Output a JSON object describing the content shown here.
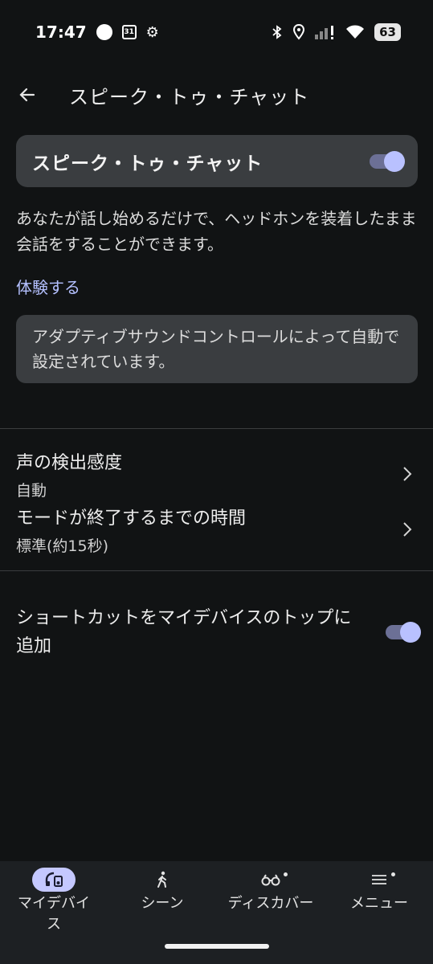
{
  "status_bar": {
    "time": "17:47",
    "calendar_day": "31",
    "battery": "63",
    "icons": [
      "circle-notification-icon",
      "calendar-icon",
      "gear-icon",
      "bluetooth-icon",
      "location-icon",
      "signal-icon",
      "wifi-icon",
      "battery-icon"
    ]
  },
  "appbar": {
    "back_icon": "arrow-left-icon",
    "title": "スピーク・トゥ・チャット"
  },
  "main_toggle": {
    "label": "スピーク・トゥ・チャット",
    "state": "on"
  },
  "description": "あなたが話し始めるだけで、ヘッドホンを装着したまま会話をすることができます。",
  "try_link": "体験する",
  "info_card": "アダプティブサウンドコントロールによって自動で設定されています。",
  "settings": [
    {
      "title": "声の検出感度",
      "value": "自動"
    },
    {
      "title": "モードが終了するまでの時間",
      "value": "標準(約15秒)"
    }
  ],
  "shortcut": {
    "label": "ショートカットをマイデバイスのトップに追加",
    "state": "on"
  },
  "bottom_nav": [
    {
      "label": "マイデバイス",
      "icon": "headphones-device-icon",
      "active": true
    },
    {
      "label": "シーン",
      "icon": "walking-person-icon",
      "active": false
    },
    {
      "label": "ディスカバー",
      "icon": "binoculars-icon",
      "active": false
    },
    {
      "label": "メニュー",
      "icon": "menu-lines-icon",
      "active": false
    }
  ],
  "colors": {
    "background": "#111314",
    "card": "#3a3d40",
    "accent": "#b9c1ff",
    "link": "#b4c0ff",
    "nav_bg": "#1d2023"
  }
}
